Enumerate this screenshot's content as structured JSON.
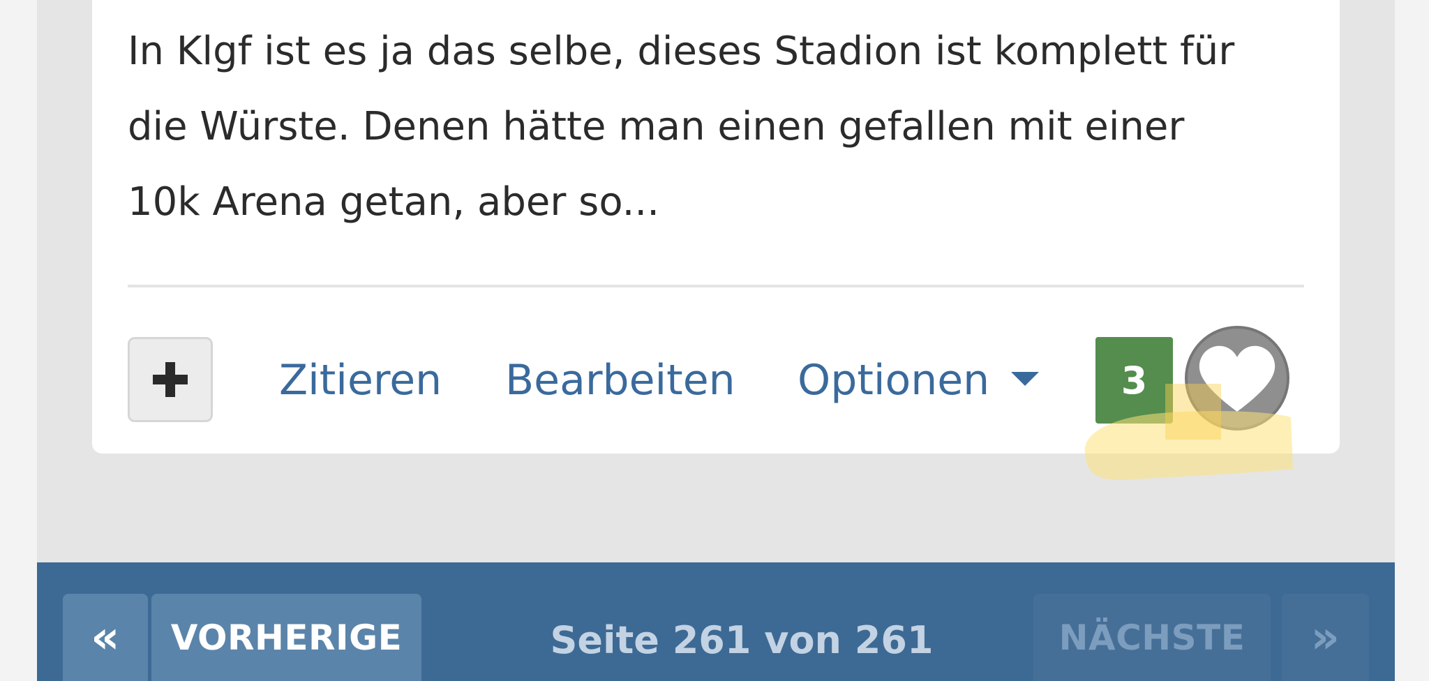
{
  "post": {
    "text": "In Klgf ist es ja das selbe, dieses Stadion ist komplett für die Würste. Denen hätte man einen gefallen mit einer 10k Arena getan, aber so..."
  },
  "actions": {
    "quote_label": "Zitieren",
    "edit_label": "Bearbeiten",
    "options_label": "Optionen",
    "like_count": "3"
  },
  "pagination": {
    "first_glyph": "«",
    "prev_label": "VORHERIGE",
    "page_info": "Seite 261 von 261",
    "next_label": "NÄCHSTE",
    "last_glyph": "»"
  },
  "icons": {
    "plus": "plus-icon",
    "caret": "caret-down-icon",
    "heart": "heart-icon"
  },
  "colors": {
    "link": "#3a6a9c",
    "like_green": "#548d4d",
    "pager_bg": "#3d6a94",
    "highlight": "#fde27a"
  }
}
